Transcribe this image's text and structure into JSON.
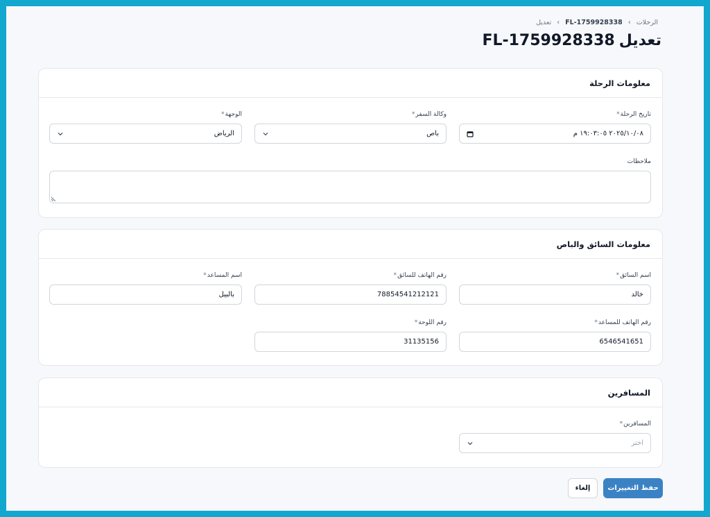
{
  "breadcrumb": {
    "root": "الرحلات",
    "trip_code": "FL-1759928338",
    "current": "تعديل"
  },
  "page_title": {
    "action": "تعديل",
    "code": "FL-1759928338"
  },
  "trip_info": {
    "title": "معلومات الرحلة",
    "date": {
      "label": "تاريخ الرحلة",
      "required_mark": "*",
      "value": "٢٠٢٥/١٠/٠٨ ١٩:٠٣:٠٥ م"
    },
    "agency": {
      "label": "وكالة السفر",
      "required_mark": "*",
      "value": "باص"
    },
    "destination": {
      "label": "الوجهة",
      "required_mark": "*",
      "value": "الرياض"
    },
    "notes": {
      "label": "ملاحظات",
      "value": ""
    }
  },
  "driver_info": {
    "title": "معلومات السائق والباص",
    "driver_name": {
      "label": "اسم السائق",
      "required_mark": "*",
      "value": "خالد"
    },
    "driver_phone": {
      "label": "رقم الهاتف للسائق",
      "required_mark": "*",
      "value": "78854541212121"
    },
    "assistant_name": {
      "label": "اسم المساعد",
      "required_mark": "*",
      "value": "بالبيل"
    },
    "assistant_phone": {
      "label": "رقم الهاتف للمساعد",
      "required_mark": "*",
      "value": "6546541651"
    },
    "plate_number": {
      "label": "رقم اللوحة",
      "required_mark": "*",
      "value": "31135156"
    }
  },
  "passengers": {
    "title": "المسافرين",
    "field": {
      "label": "المسافرين",
      "required_mark": "*",
      "placeholder": "اختر"
    }
  },
  "actions": {
    "save": "حفظ التغييرات",
    "cancel": "إلغاء"
  },
  "colors": {
    "frame": "#12a7cf",
    "primary": "#3b82c4",
    "background": "#f6f8fb"
  }
}
